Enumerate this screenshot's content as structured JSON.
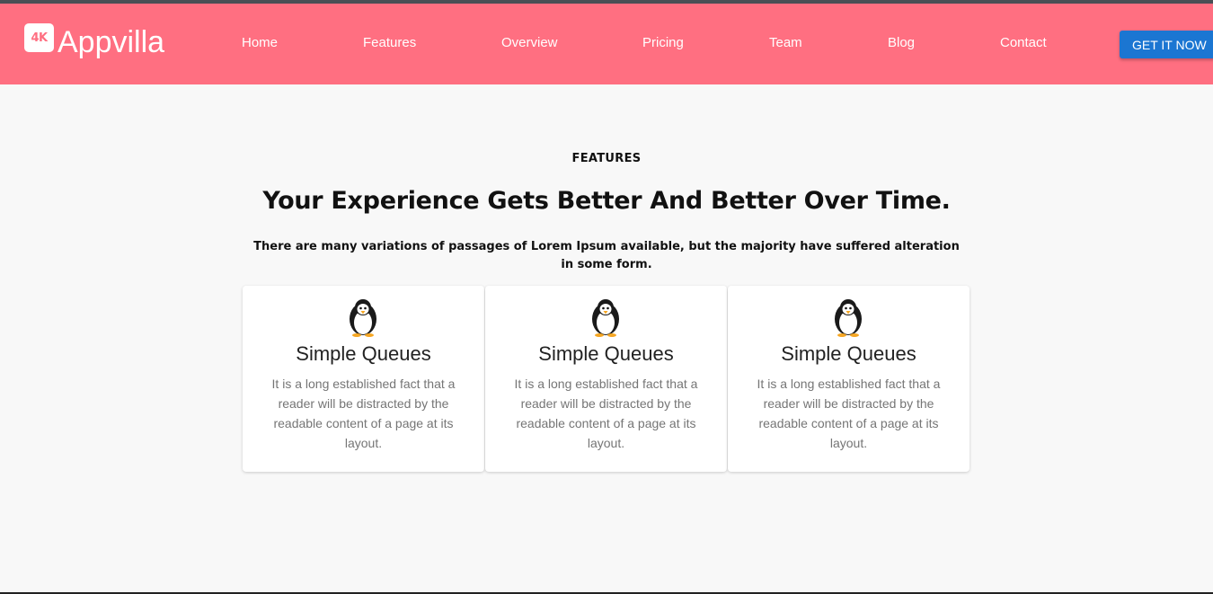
{
  "brand": {
    "badge": "4K",
    "name": "Appvilla"
  },
  "nav": {
    "items": [
      {
        "label": "Home"
      },
      {
        "label": "Features"
      },
      {
        "label": "Overview"
      },
      {
        "label": "Pricing"
      },
      {
        "label": "Team"
      },
      {
        "label": "Blog"
      },
      {
        "label": "Contact"
      }
    ],
    "cta_label": "GET IT NOW"
  },
  "colors": {
    "navbar": "#ff6f81",
    "cta": "#1b76d2",
    "page_bg": "#f8f8f8"
  },
  "section": {
    "eyebrow": "FEATURES",
    "headline": "Your Experience Gets Better And Better Over Time.",
    "subtext": "There are many variations of passages of Lorem Ipsum available, but the majority have suffered alteration in some form."
  },
  "cards": [
    {
      "icon": "penguin-icon",
      "title": "Simple Queues",
      "text": "It is a long established fact that a reader will be distracted by the readable content of a page at its layout."
    },
    {
      "icon": "penguin-icon",
      "title": "Simple Queues",
      "text": "It is a long established fact that a reader will be distracted by the readable content of a page at its layout."
    },
    {
      "icon": "penguin-icon",
      "title": "Simple Queues",
      "text": "It is a long established fact that a reader will be distracted by the readable content of a page at its layout."
    }
  ]
}
